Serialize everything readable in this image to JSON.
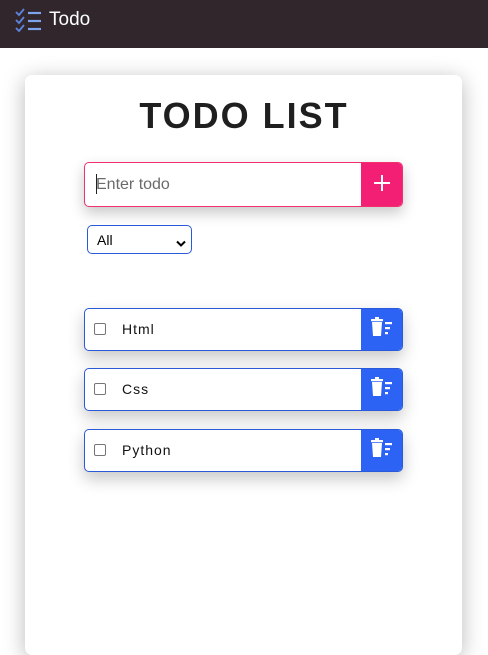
{
  "navbar": {
    "title": "Todo",
    "logo_icon": "checklist-icon",
    "background": "#30262b"
  },
  "heading": "TODO LIST",
  "add_form": {
    "placeholder": "Enter todo",
    "value": "",
    "button_icon": "plus-icon",
    "accent": "#f21f74"
  },
  "filter": {
    "selected": "All",
    "options": [
      "All"
    ]
  },
  "todos": [
    {
      "text": "Html",
      "checked": false,
      "delete_icon": "trash-sort-icon"
    },
    {
      "text": "Css",
      "checked": false,
      "delete_icon": "trash-sort-icon"
    },
    {
      "text": "Python",
      "checked": false,
      "delete_icon": "trash-sort-icon"
    }
  ],
  "colors": {
    "delete_button": "#2d63f5",
    "todo_border": "#2b5ad8"
  }
}
